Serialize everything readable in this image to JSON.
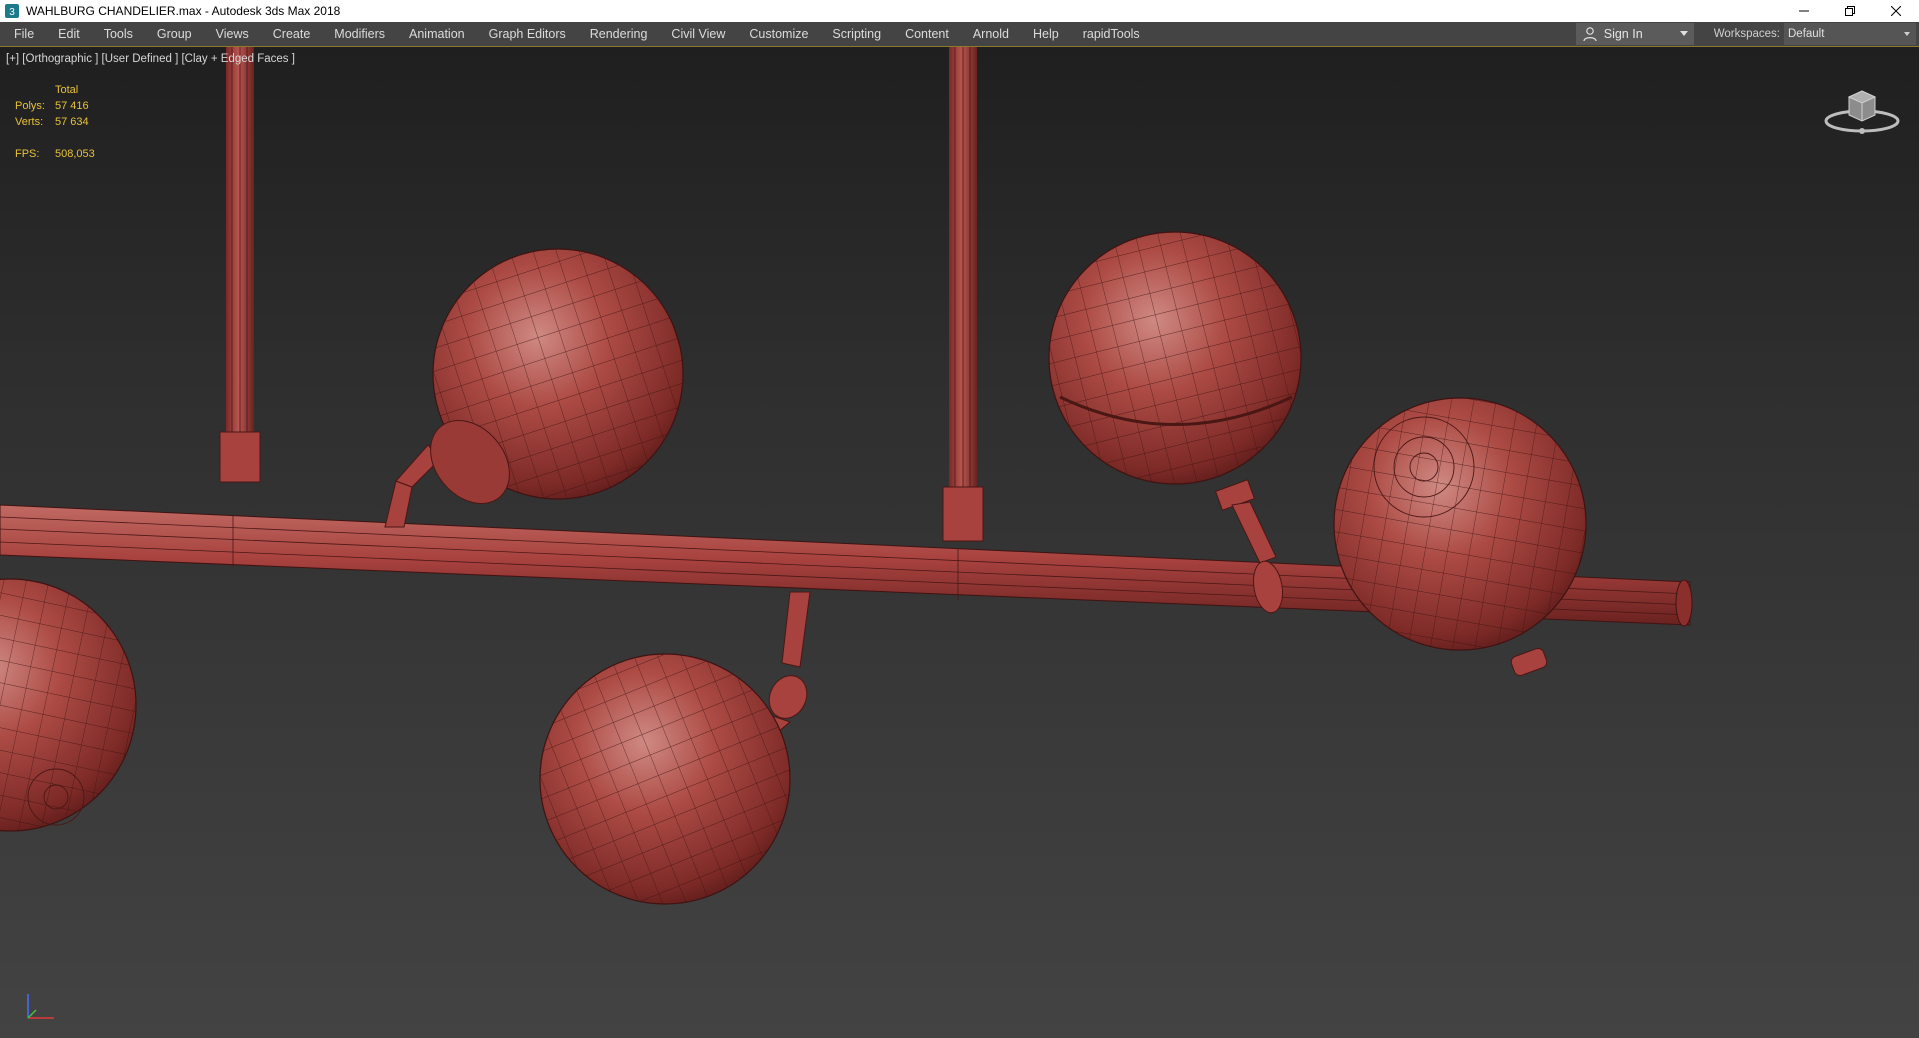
{
  "window": {
    "title": "WAHLBURG CHANDELIER.max - Autodesk 3ds Max 2018",
    "app_icon": "3ds-max-icon",
    "controls": [
      "minimize-icon",
      "restore-icon",
      "close-icon"
    ]
  },
  "menu": {
    "items": [
      "File",
      "Edit",
      "Tools",
      "Group",
      "Views",
      "Create",
      "Modifiers",
      "Animation",
      "Graph Editors",
      "Rendering",
      "Civil View",
      "Customize",
      "Scripting",
      "Content",
      "Arnold",
      "Help",
      "rapidTools"
    ],
    "sign_in": "Sign In",
    "workspaces_label": "Workspaces:",
    "workspace_value": "Default"
  },
  "viewport": {
    "label": "[+] [Orthographic ] [User Defined ] [Clay + Edged Faces ]",
    "stats": {
      "header": "Total",
      "polys_label": "Polys:",
      "polys_value": "57 416",
      "verts_label": "Verts:",
      "verts_value": "57 634",
      "fps_label": "FPS:",
      "fps_value": "508,053"
    },
    "viewcube_icon": "viewcube-icon",
    "axis_icon": "axis-tripod-icon",
    "colors": {
      "clay": "#a8423f",
      "clay_dark": "#6e2421",
      "clay_light": "#c97a74",
      "stats_text": "#e8c23a"
    }
  }
}
